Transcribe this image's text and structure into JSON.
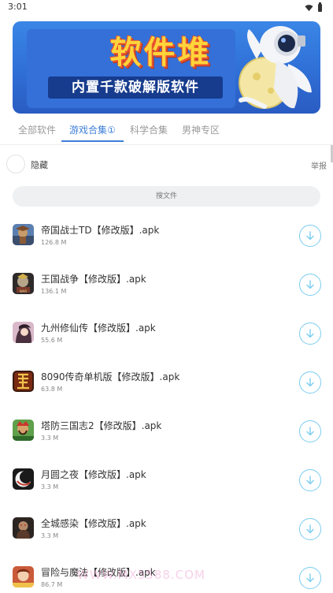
{
  "status_bar": {
    "time": "3:01"
  },
  "banner": {
    "title": "软件堆",
    "subtitle": "内置千款破解版软件"
  },
  "tabs": [
    {
      "label": "全部软件",
      "active": false
    },
    {
      "label": "游戏合集①",
      "active": true
    },
    {
      "label": "科学合集",
      "active": false
    },
    {
      "label": "男神专区",
      "active": false
    }
  ],
  "hide_label": "隐藏",
  "report_label": "举报",
  "search": {
    "placeholder": "搜文件"
  },
  "files": [
    {
      "name": "帝国战士TD【修改版】.apk",
      "size": "126.8 M",
      "icon": "game-icon-empire-td"
    },
    {
      "name": "王国战争【修改版】.apk",
      "size": "136.1 M",
      "icon": "game-icon-kingdom-war"
    },
    {
      "name": "九州修仙传【修改版】.apk",
      "size": "55.6 M",
      "icon": "game-icon-jiuzhou"
    },
    {
      "name": "8090传奇单机版【修改版】.apk",
      "size": "63.8 M",
      "icon": "game-icon-8090"
    },
    {
      "name": "塔防三国志2【修改版】.apk",
      "size": "3.3 M",
      "icon": "game-icon-tower-three-kingdoms"
    },
    {
      "name": "月圆之夜【修改版】.apk",
      "size": "3.3 M",
      "icon": "game-icon-full-moon"
    },
    {
      "name": "全城感染【修改版】.apk",
      "size": "3.3 M",
      "icon": "game-icon-city-infection"
    },
    {
      "name": "冒险与魔法【修改版】.apk",
      "size": "86.7 M",
      "icon": "game-icon-adventure-magic"
    }
  ],
  "watermark": "WWW.MX5588.COM",
  "colors": {
    "accent": "#3f7fd9",
    "download": "#7ccdf0",
    "banner_bg": "#3a86e6",
    "banner_title": "#ffd43b"
  }
}
